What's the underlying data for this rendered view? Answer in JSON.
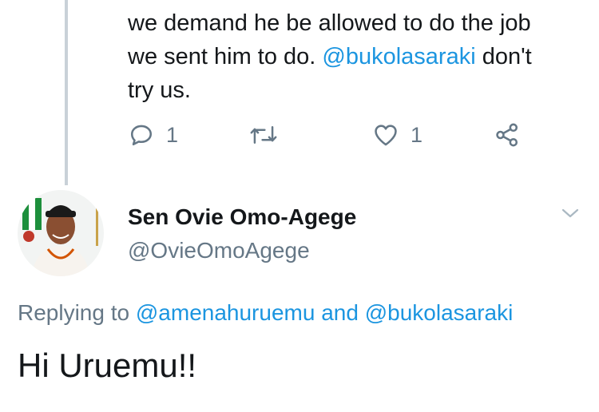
{
  "previous_tweet": {
    "line1": "we demand he be allowed to do the job",
    "line2_pre": "we sent him to do. ",
    "mention": "@bukolasaraki",
    "line2_post": " don't",
    "line3": "try us.",
    "reply_count": "1",
    "like_count": "1"
  },
  "tweet": {
    "author_name": "Sen Ovie Omo-Agege",
    "author_handle": "@OvieOmoAgege",
    "replying_prefix": "Replying to ",
    "replying_user1": "@amenahuruemu",
    "replying_and": " and ",
    "replying_user2": "@bukolasaraki",
    "text": "Hi Uruemu!!"
  },
  "colors": {
    "link": "#1b95e0",
    "secondary_text": "#657786",
    "thread_line": "#c9d1d8"
  },
  "icons": [
    "reply-icon",
    "retweet-icon",
    "like-icon",
    "share-icon",
    "chevron-down-icon"
  ]
}
